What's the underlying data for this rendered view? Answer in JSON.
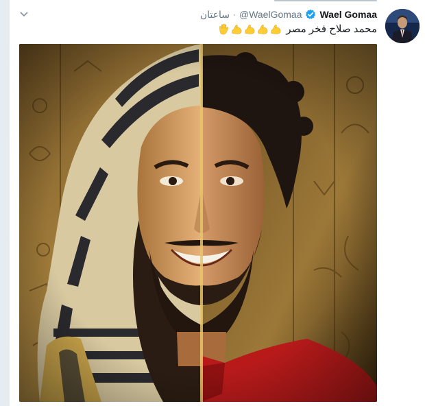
{
  "tweet": {
    "author_name": "Wael Gomaa",
    "handle": "@WaelGomaa",
    "time_ago": "ساعتان",
    "text": "محمد صلاح فخر مصر",
    "emojis": [
      "flexed-biceps",
      "flexed-biceps",
      "flexed-biceps",
      "flexed-biceps",
      "raised-hand"
    ],
    "verified": true
  },
  "icons": {
    "caret": "chevron-down-icon",
    "verified": "verified-badge-icon"
  },
  "colors": {
    "name": "#14171a",
    "meta": "#657786",
    "verified": "#1da1f2",
    "emoji": "#ffcc33"
  }
}
